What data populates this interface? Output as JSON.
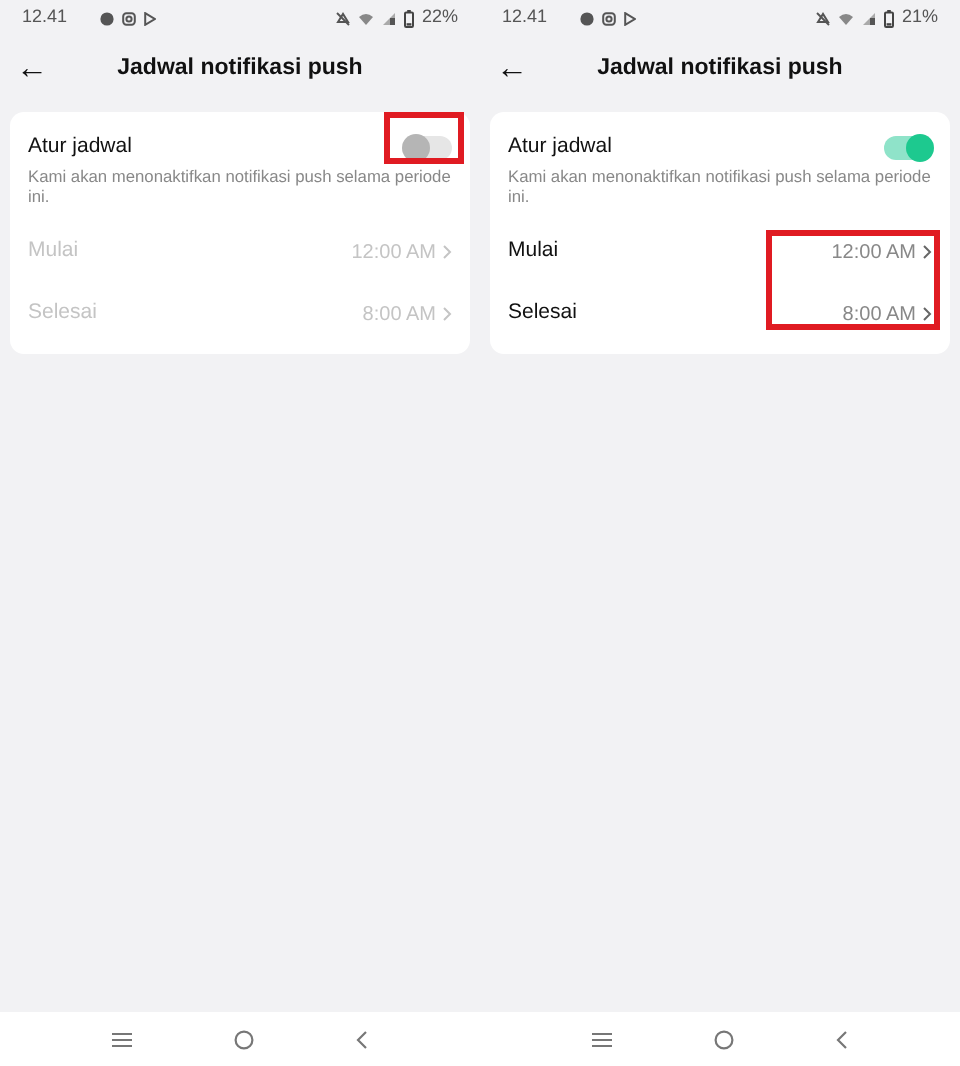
{
  "screens": [
    {
      "status_bar": {
        "time": "12.41",
        "battery": "22%"
      },
      "header": {
        "back": "←",
        "title": "Jadwal notifikasi push"
      },
      "schedule": {
        "label": "Atur jadwal",
        "on": false,
        "description": "Kami akan menonaktifkan notifikasi push selama periode ini.",
        "rows": [
          {
            "label": "Mulai",
            "value": "12:00 AM",
            "disabled": true
          },
          {
            "label": "Selesai",
            "value": "8:00 AM",
            "disabled": true
          }
        ],
        "toggle_highlighted": true,
        "times_highlighted": false
      }
    },
    {
      "status_bar": {
        "time": "12.41",
        "battery": "21%"
      },
      "header": {
        "back": "←",
        "title": "Jadwal notifikasi push"
      },
      "schedule": {
        "label": "Atur jadwal",
        "on": true,
        "description": "Kami akan menonaktifkan notifikasi push selama periode ini.",
        "rows": [
          {
            "label": "Mulai",
            "value": "12:00 AM",
            "disabled": false
          },
          {
            "label": "Selesai",
            "value": "8:00 AM",
            "disabled": false
          }
        ],
        "toggle_highlighted": false,
        "times_highlighted": true
      }
    }
  ]
}
